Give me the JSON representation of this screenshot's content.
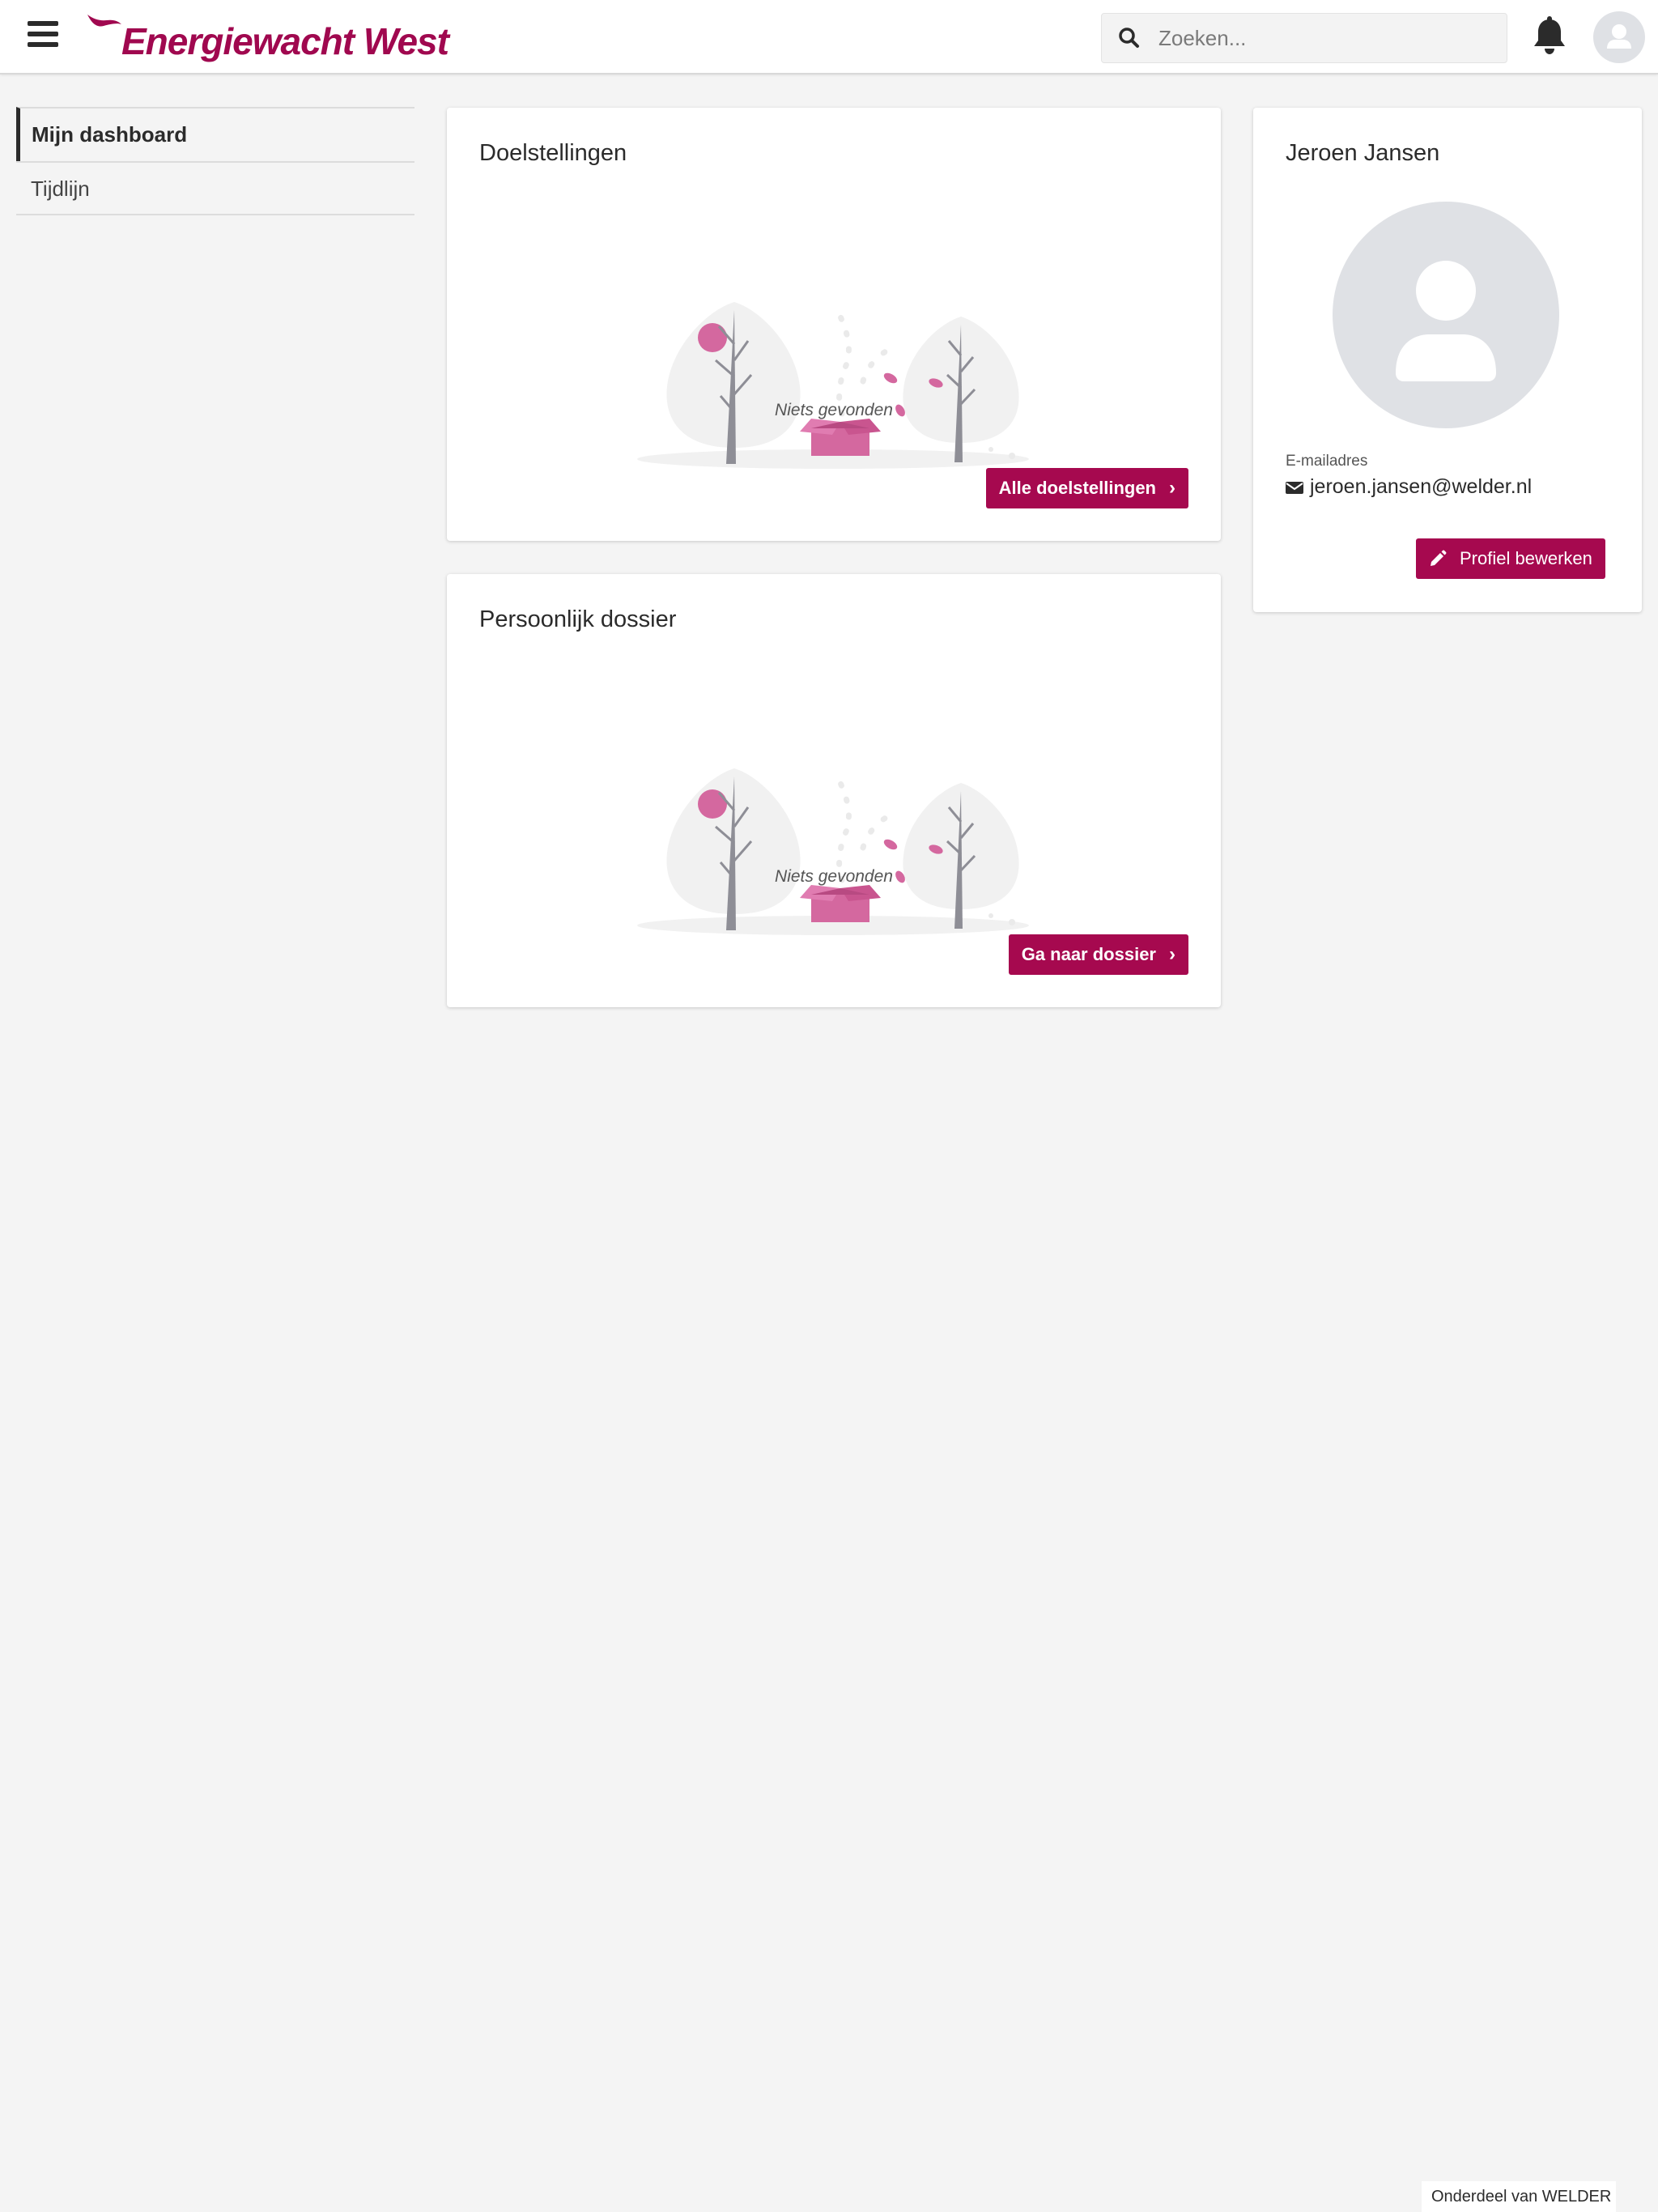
{
  "header": {
    "brand": "Energiewacht West",
    "search_placeholder": "Zoeken...",
    "brand_color": "#a0084f"
  },
  "sidebar": {
    "items": [
      {
        "label": "Mijn dashboard",
        "active": true
      },
      {
        "label": "Tijdlijn",
        "active": false
      }
    ]
  },
  "cards": {
    "goals": {
      "title": "Doelstellingen",
      "empty_text": "Niets gevonden",
      "button_label": "Alle doelstellingen"
    },
    "dossier": {
      "title": "Persoonlijk dossier",
      "empty_text": "Niets gevonden",
      "button_label": "Ga naar dossier"
    }
  },
  "profile": {
    "name": "Jeroen Jansen",
    "email_label": "E-mailadres",
    "email": "jeroen.jansen@welder.nl",
    "edit_button_label": "Profiel bewerken"
  },
  "footer": {
    "tag": "Onderdeel van WELDER"
  },
  "icons": [
    "menu-icon",
    "search-icon",
    "bell-icon",
    "user-icon",
    "chevron-right-icon",
    "envelope-icon",
    "pencil-icon"
  ],
  "colors": {
    "accent": "#a6094f",
    "background": "#f4f4f4",
    "illustration_pink": "#d4689f"
  }
}
